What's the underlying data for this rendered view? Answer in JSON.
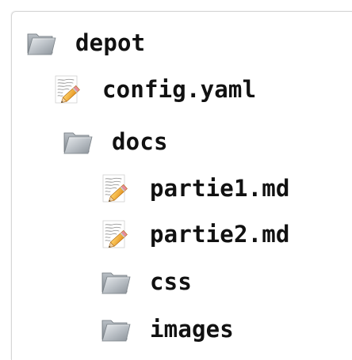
{
  "tree": {
    "root": {
      "label": "depot",
      "icon": "folder-icon"
    },
    "items": [
      {
        "label": "config.yaml",
        "icon": "text-document-icon"
      },
      {
        "label": "docs",
        "icon": "folder-icon"
      },
      {
        "label": "partie1.md",
        "icon": "text-document-icon"
      },
      {
        "label": "partie2.md",
        "icon": "text-document-icon"
      },
      {
        "label": "css",
        "icon": "folder-icon"
      },
      {
        "label": "images",
        "icon": "folder-icon"
      }
    ]
  },
  "colors": {
    "text": "#111111",
    "folder": "#9aa1a8",
    "pencil": "#f2a833"
  }
}
